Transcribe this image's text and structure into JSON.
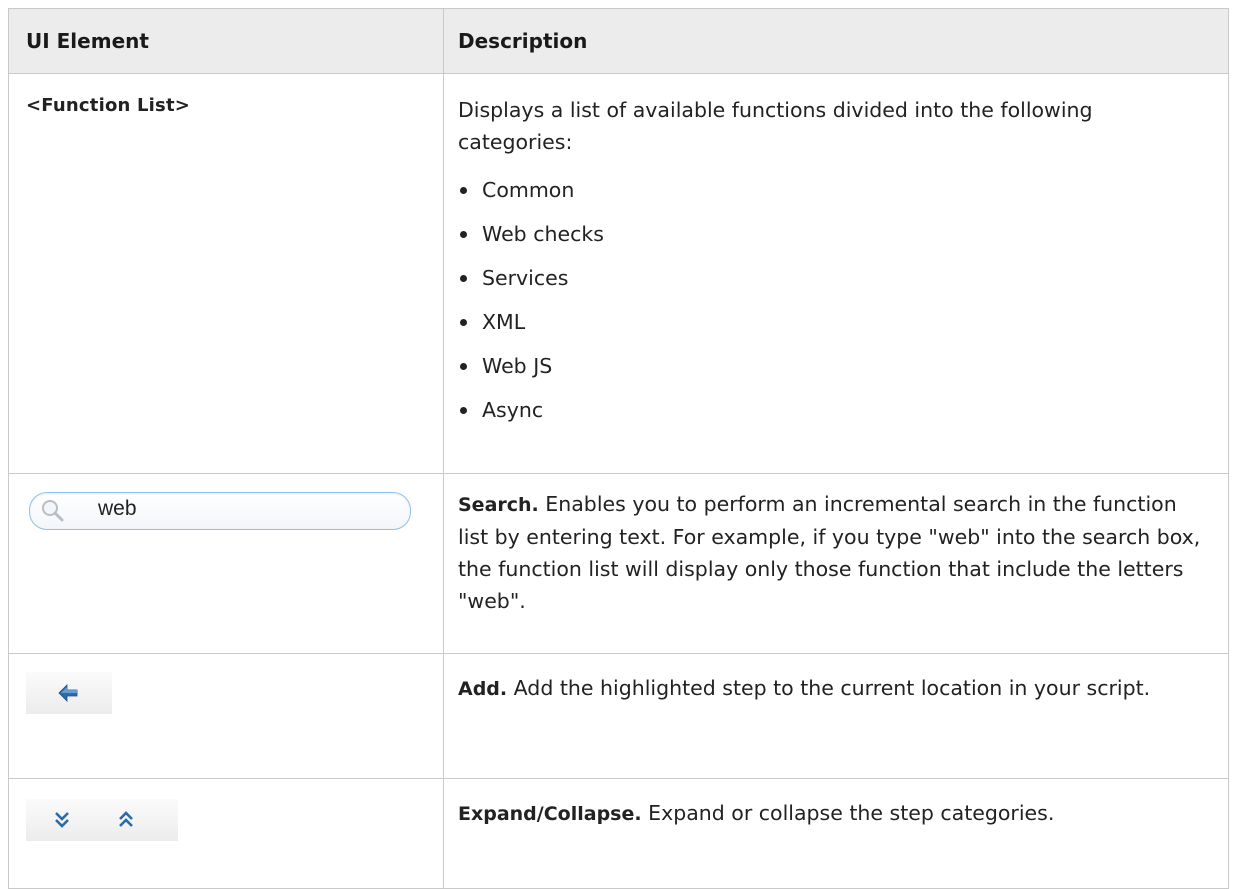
{
  "table": {
    "headers": {
      "element": "UI Element",
      "description": "Description"
    },
    "rows": [
      {
        "element": "<Function List>",
        "description": "Displays a list of available functions divided into the following categories:",
        "categories": [
          "Common",
          "Web checks",
          "Services",
          "XML",
          "Web JS",
          "Async"
        ]
      },
      {
        "element_icon": "search-box-icon",
        "element_value": "web",
        "lead": "Search.",
        "description": " Enables you to perform an incremental search in the function list by entering text. For example, if you type \"web\" into the search box, the function list will display only those function that include the letters \"web\"."
      },
      {
        "element_icon": "arrow-left-icon",
        "lead": "Add.",
        "description": " Add the highlighted step to the current location in your script."
      },
      {
        "element_icons": [
          "expand-icon",
          "collapse-icon"
        ],
        "lead": "Expand/Collapse.",
        "description": " Expand or collapse the step categories."
      }
    ]
  },
  "colors": {
    "border": "#c9c9c9",
    "header_bg": "#ececec",
    "icon_blue": "#2d6aa8"
  }
}
